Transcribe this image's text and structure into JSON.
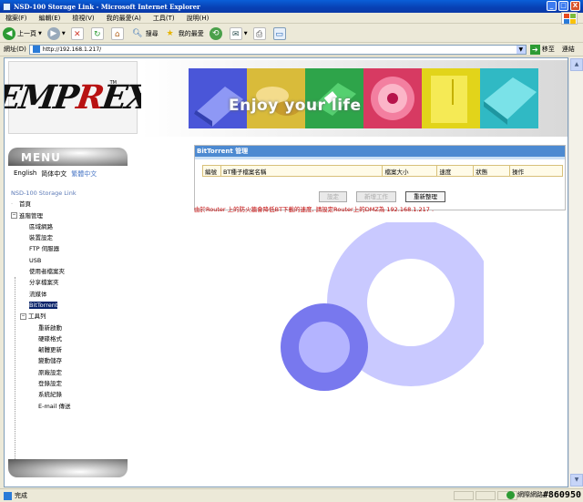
{
  "window": {
    "title": "NSD-100 Storage Link - Microsoft Internet Explorer",
    "buttons": [
      "_",
      "□",
      "X"
    ]
  },
  "menubar": [
    "檔案(F)",
    "編輯(E)",
    "檢視(V)",
    "我的最愛(A)",
    "工具(T)",
    "說明(H)"
  ],
  "toolbar": {
    "back": "上一頁",
    "search": "搜尋",
    "favorites": "我的最愛"
  },
  "address": {
    "label": "網址(D)",
    "url": "http://192.168.1.217/",
    "go": "移至",
    "links": "連結"
  },
  "header": {
    "logo": "EMPREX",
    "logo_tm": "TM",
    "banner_text": "Enjoy your life"
  },
  "sidebar": {
    "menu_title": "MENU",
    "lang_en": "English",
    "lang_zh_cn": "简体中文",
    "lang_zh_tw": "繁體中文",
    "tree": {
      "root": "NSD-100 Storage Link",
      "home": "首頁",
      "advanced": "進階管理",
      "advanced_items": [
        "區域網路",
        "裝置設定",
        "FTP 伺服器",
        "USB",
        "使用者檔案夾",
        "分享檔案夾",
        "流媒体",
        "BitTorrent"
      ],
      "tools": "工具列",
      "tools_items": [
        "重新啟動",
        "硬碟格式",
        "韌體更新",
        "變動儲存",
        "原廠設定",
        "登錄設定",
        "系統紀錄",
        "E-mail 傳送"
      ]
    }
  },
  "panel": {
    "title": "BitTorrent 管理",
    "columns": [
      "編號",
      "BT種子檔案名稱",
      "檔案大小",
      "速度",
      "狀態",
      "操作"
    ],
    "buttons": {
      "settings": "設定",
      "new_task": "新增工作",
      "refresh": "重新整理"
    },
    "notice": "由於Router 上的防火牆會降低BT下載的速度, 請設定Router上的DMZ為 192.168.1.217 ."
  },
  "statusbar": {
    "text": "完成",
    "zone": "網際網路",
    "watermark": "#860950"
  },
  "colors": {
    "title_bar": "#0840b4",
    "panel_header": "#4d8ad1",
    "notice": "#c00000",
    "selected": "#0a246a",
    "ring_large": "#c9c9ff",
    "ring_small": "#7878ee"
  }
}
